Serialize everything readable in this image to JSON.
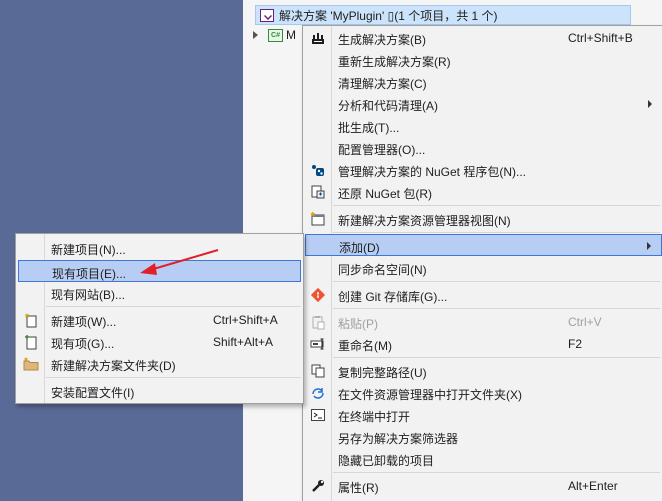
{
  "explorer": {
    "solution_label": "解决方案 'MyPlugin' ▯(1 个项目，共 1 个)",
    "project_label": "M"
  },
  "context_menu": {
    "items": [
      {
        "label": "生成解决方案(B)",
        "shortcut": "Ctrl+Shift+B",
        "icon": "build-icon"
      },
      {
        "label": "重新生成解决方案(R)"
      },
      {
        "label": "清理解决方案(C)"
      },
      {
        "label": "分析和代码清理(A)",
        "submenu": true
      },
      {
        "label": "批生成(T)..."
      },
      {
        "label": "配置管理器(O)..."
      },
      {
        "label": "管理解决方案的 NuGet 程序包(N)...",
        "icon": "nuget-icon"
      },
      {
        "label": "还原 NuGet 包(R)",
        "icon": "restore-icon"
      },
      {
        "label": "新建解决方案资源管理器视图(N)",
        "icon": "new-view-icon"
      },
      {
        "label": "添加(D)",
        "submenu": true,
        "highlighted": true
      },
      {
        "label": "同步命名空间(N)"
      },
      {
        "label": "创建 Git 存储库(G)...",
        "icon": "git-icon"
      },
      {
        "label": "粘贴(P)",
        "shortcut": "Ctrl+V",
        "icon": "paste-icon",
        "disabled": true
      },
      {
        "label": "重命名(M)",
        "shortcut": "F2",
        "icon": "rename-icon"
      },
      {
        "label": "复制完整路径(U)",
        "icon": "copy-icon"
      },
      {
        "label": "在文件资源管理器中打开文件夹(X)",
        "icon": "open-folder-icon"
      },
      {
        "label": "在终端中打开",
        "icon": "terminal-icon"
      },
      {
        "label": "另存为解决方案筛选器"
      },
      {
        "label": "隐藏已卸载的项目"
      },
      {
        "label": "属性(R)",
        "shortcut": "Alt+Enter",
        "icon": "wrench-icon"
      }
    ]
  },
  "submenu": {
    "items": [
      {
        "label": "新建项目(N)..."
      },
      {
        "label": "现有项目(E)...",
        "highlighted": true
      },
      {
        "label": "现有网站(B)..."
      },
      {
        "label": "新建项(W)...",
        "shortcut": "Ctrl+Shift+A",
        "icon": "new-item-icon"
      },
      {
        "label": "现有项(G)...",
        "shortcut": "Shift+Alt+A",
        "icon": "existing-item-icon"
      },
      {
        "label": "新建解决方案文件夹(D)",
        "icon": "folder-icon"
      },
      {
        "label": "安装配置文件(I)"
      }
    ]
  },
  "colors": {
    "highlight_bg": "#b8cdf4",
    "highlight_border": "#3c78d8",
    "annotation_arrow": "#e0202a",
    "background": "#5a6a96"
  }
}
